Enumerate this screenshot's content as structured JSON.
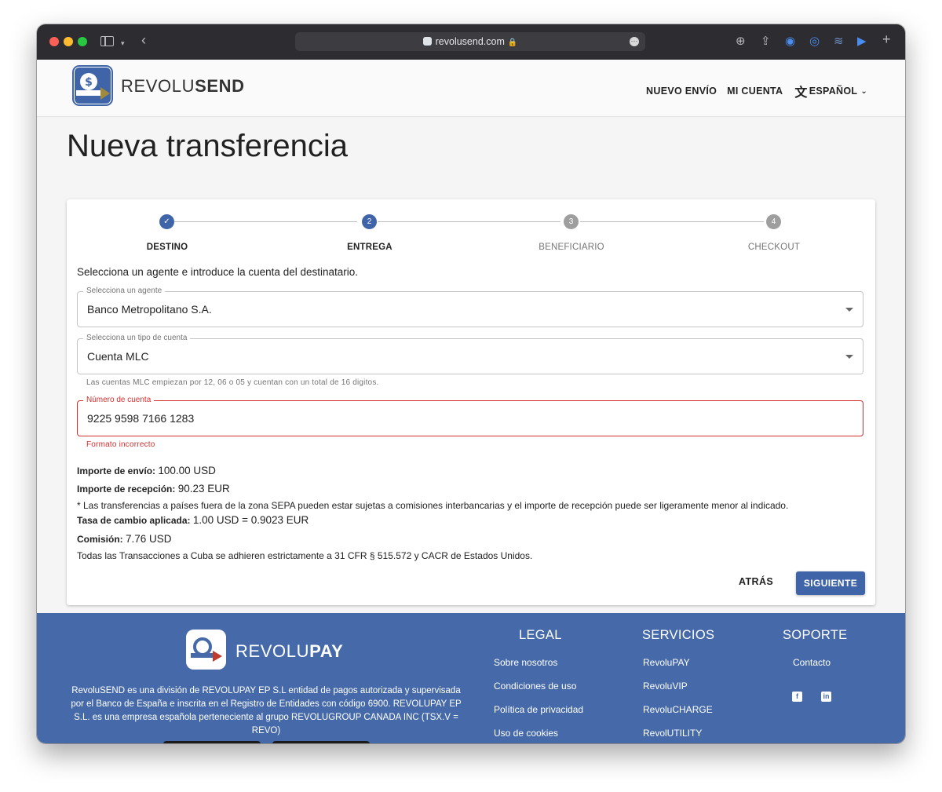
{
  "browser": {
    "url": "revolusend.com"
  },
  "header": {
    "brand_part1": "REVOLU",
    "brand_part2": "SEND",
    "nav": {
      "new_send": "NUEVO ENVÍO",
      "my_account": "MI CUENTA",
      "language": "ESPAÑOL"
    }
  },
  "page": {
    "title": "Nueva transferencia"
  },
  "stepper": {
    "steps": [
      {
        "number": "1",
        "label": "DESTINO",
        "state": "done"
      },
      {
        "number": "2",
        "label": "ENTREGA",
        "state": "active"
      },
      {
        "number": "3",
        "label": "BENEFICIARIO",
        "state": "todo"
      },
      {
        "number": "4",
        "label": "CHECKOUT",
        "state": "todo"
      }
    ]
  },
  "form": {
    "instruction": "Selecciona un agente e introduce la cuenta del destinatario.",
    "agent": {
      "label": "Selecciona un agente",
      "value": "Banco Metropolitano S.A."
    },
    "account_type": {
      "label": "Selecciona un tipo de cuenta",
      "value": "Cuenta MLC",
      "helper": "Las cuentas MLC empiezan por 12, 06 o 05 y cuentan con un total de 16 digitos."
    },
    "account_number": {
      "label": "Número de cuenta",
      "value": "9225 9598 7166 1283",
      "error": "Formato incorrecto"
    }
  },
  "summary": {
    "send_label": "Importe de envío:",
    "send_value": "100.00 USD",
    "receive_label": "Importe de recepción:",
    "receive_value": "90.23 EUR",
    "sepa_note": "* Las transferencias a países fuera de la zona SEPA pueden estar sujetas a comisiones interbancarias y el importe de recepción puede ser ligeramente menor al indicado.",
    "rate_label": "Tasa de cambio aplicada:",
    "rate_value": "1.00 USD = 0.9023 EUR",
    "fee_label": "Comisión:",
    "fee_value": "7.76 USD",
    "cuba_note": "Todas las Transacciones a Cuba se adhieren estrictamente a 31 CFR § 515.572 y CACR de Estados Unidos."
  },
  "actions": {
    "back": "ATRÁS",
    "next": "SIGUIENTE"
  },
  "footer": {
    "brand_part1": "REVOLU",
    "brand_part2": "PAY",
    "description": "RevoluSEND es una división de REVOLUPAY EP S.L entidad de pagos autorizada y supervisada por el Banco de España e inscrita en el Registro de Entidades con código 6900. REVOLUPAY EP S.L. es una empresa española perteneciente al grupo REVOLUGROUP CANADA INC (TSX.V = REVO)",
    "legal": {
      "title": "LEGAL",
      "links": [
        "Sobre nosotros",
        "Condiciones de uso",
        "Política de privacidad",
        "Uso de cookies"
      ]
    },
    "services": {
      "title": "SERVICIOS",
      "links": [
        "RevoluPAY",
        "RevoluVIP",
        "RevoluCHARGE",
        "RevolUTILITY"
      ]
    },
    "support": {
      "title": "SOPORTE",
      "links": [
        "Contacto"
      ]
    }
  },
  "colors": {
    "primary": "#3f65a8",
    "footer_bg": "#466aa9",
    "error": "#d32f2f"
  }
}
